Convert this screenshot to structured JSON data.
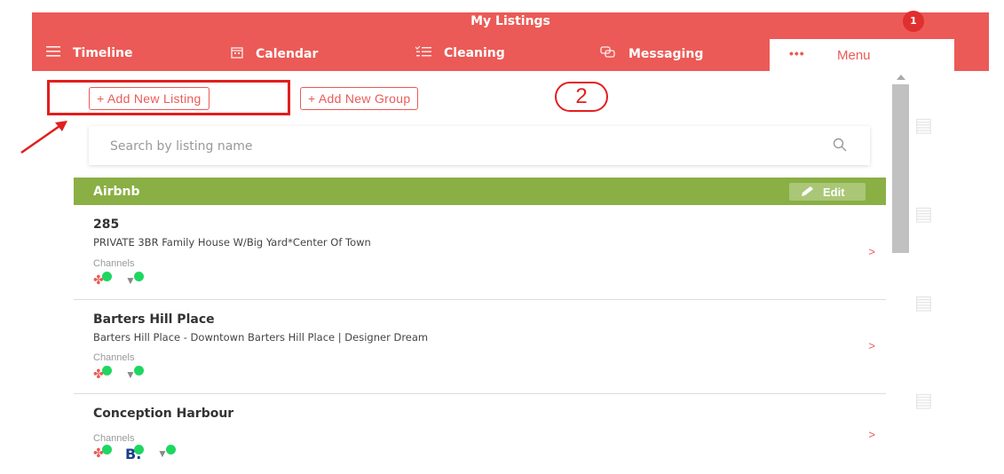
{
  "header": {
    "title": "My Listings",
    "nav": [
      {
        "label": "Timeline",
        "icon": "list-icon"
      },
      {
        "label": "Calendar",
        "icon": "calendar-icon"
      },
      {
        "label": "Cleaning",
        "icon": "checklist-icon"
      },
      {
        "label": "Messaging",
        "icon": "chat-icon"
      }
    ],
    "menu": {
      "dots": "•••",
      "label": "Menu",
      "badge": "1"
    },
    "accent": "#eb5a56"
  },
  "actions": {
    "add_listing": "+ Add New Listing",
    "add_group": "+ Add New Group"
  },
  "annotation": {
    "step": "2"
  },
  "search": {
    "placeholder": "Search by listing name"
  },
  "group": {
    "name": "Airbnb",
    "edit_label": "Edit",
    "color": "#8aaf44"
  },
  "listings": [
    {
      "title": "285",
      "subtitle": "PRIVATE 3BR Family House W/Big Yard*Center Of Town",
      "channels_label": "Channels",
      "channels": [
        "airbnb-icon",
        "vrbo-icon"
      ]
    },
    {
      "title": "Barters Hill Place",
      "subtitle": "Barters Hill Place - Downtown Barters Hill Place | Designer Dream",
      "channels_label": "Channels",
      "channels": [
        "airbnb-icon",
        "vrbo-icon"
      ]
    },
    {
      "title": "Conception Harbour",
      "subtitle": "",
      "channels_label": "Channels",
      "channels": [
        "airbnb-icon",
        "booking-icon",
        "vrbo-icon"
      ],
      "booking_text": "B."
    }
  ],
  "chevron": ">"
}
